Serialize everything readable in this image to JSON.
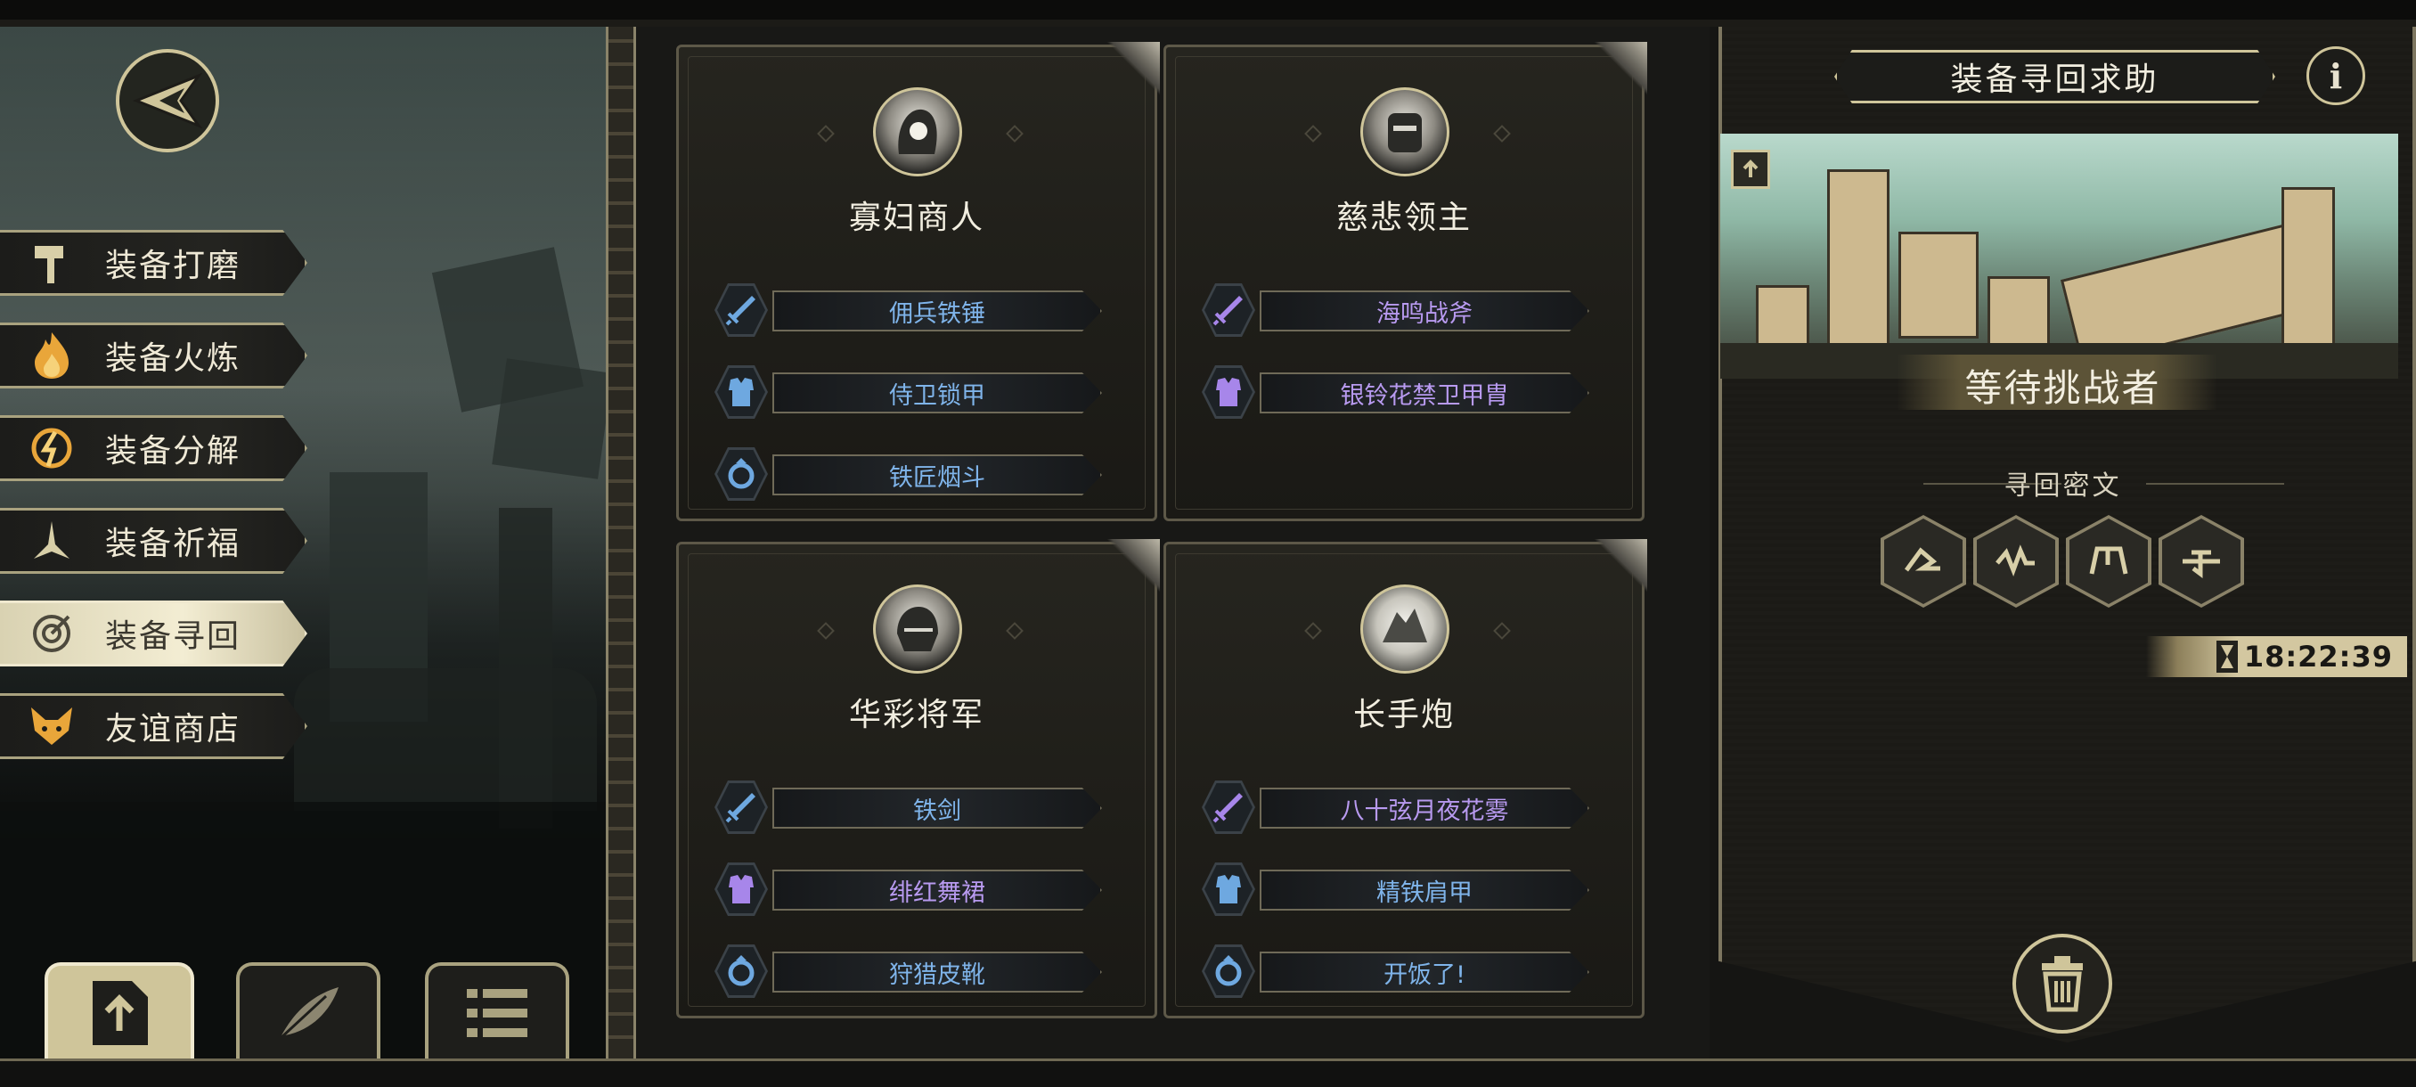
{
  "left_menu": {
    "items": [
      {
        "label": "装备打磨",
        "icon": "hammer-icon"
      },
      {
        "label": "装备火炼",
        "icon": "flame-icon"
      },
      {
        "label": "装备分解",
        "icon": "disassemble-icon"
      },
      {
        "label": "装备祈福",
        "icon": "pray-icon"
      },
      {
        "label": "装备寻回",
        "icon": "target-icon",
        "active": true
      },
      {
        "label": "友谊商店",
        "icon": "fox-icon"
      }
    ]
  },
  "bottom_tabs": [
    {
      "icon": "upload-icon",
      "active": true
    },
    {
      "icon": "feather-icon"
    },
    {
      "icon": "list-icon"
    }
  ],
  "cards": [
    {
      "name": "寡妇商人",
      "items": [
        {
          "label": "佣兵铁锤",
          "type": "weapon",
          "rarity": "blue"
        },
        {
          "label": "侍卫锁甲",
          "type": "armor",
          "rarity": "blue"
        },
        {
          "label": "铁匠烟斗",
          "type": "accessory",
          "rarity": "blue"
        }
      ]
    },
    {
      "name": "慈悲领主",
      "items": [
        {
          "label": "海鸣战斧",
          "type": "weapon",
          "rarity": "purple"
        },
        {
          "label": "银铃花禁卫甲胄",
          "type": "armor",
          "rarity": "purple"
        }
      ]
    },
    {
      "name": "华彩将军",
      "items": [
        {
          "label": "铁剑",
          "type": "weapon",
          "rarity": "blue"
        },
        {
          "label": "绯红舞裙",
          "type": "armor",
          "rarity": "purple"
        },
        {
          "label": "狩猎皮靴",
          "type": "accessory",
          "rarity": "blue"
        }
      ]
    },
    {
      "name": "长手炮",
      "items": [
        {
          "label": "八十弦月夜花雾",
          "type": "weapon",
          "rarity": "purple"
        },
        {
          "label": "精铁肩甲",
          "type": "armor",
          "rarity": "blue"
        },
        {
          "label": "开饭了!",
          "type": "accessory",
          "rarity": "blue"
        }
      ]
    }
  ],
  "right_panel": {
    "title": "装备寻回求助",
    "info_icon": "i",
    "status": "等待挑战者",
    "cipher_title": "寻回密文",
    "runes": [
      "rune-1-icon",
      "rune-2-icon",
      "rune-3-icon",
      "rune-4-icon"
    ],
    "timer": "18:22:39"
  },
  "colors": {
    "gold": "#cfc59a",
    "blue_rarity": "#7fb4ea",
    "purple_rarity": "#b89af0",
    "panel_bg": "#1d1c18"
  }
}
